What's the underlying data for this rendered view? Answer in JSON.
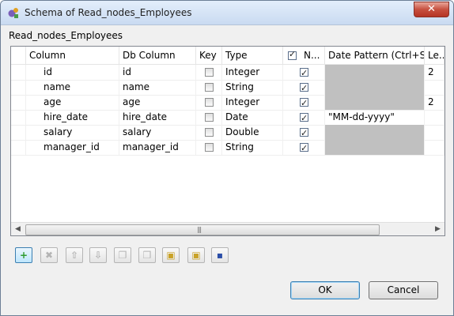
{
  "window": {
    "title": "Schema of Read_nodes_Employees",
    "close_glyph": "✕"
  },
  "schema_name": "Read_nodes_Employees",
  "table": {
    "columns": [
      "Column",
      "Db Column",
      "Key",
      "Type",
      "N...",
      "Date Pattern (Ctrl+S...",
      "Le..."
    ],
    "header_nullable_checked": true,
    "rows": [
      {
        "column": "id",
        "db_column": "id",
        "key": false,
        "type": "Integer",
        "nullable": true,
        "date_pattern": "",
        "date_pattern_disabled": true,
        "length": "2"
      },
      {
        "column": "name",
        "db_column": "name",
        "key": false,
        "type": "String",
        "nullable": true,
        "date_pattern": "",
        "date_pattern_disabled": true,
        "length": ""
      },
      {
        "column": "age",
        "db_column": "age",
        "key": false,
        "type": "Integer",
        "nullable": true,
        "date_pattern": "",
        "date_pattern_disabled": true,
        "length": "2"
      },
      {
        "column": "hire_date",
        "db_column": "hire_date",
        "key": false,
        "type": "Date",
        "nullable": true,
        "date_pattern": "\"MM-dd-yyyy\"",
        "date_pattern_disabled": false,
        "length": ""
      },
      {
        "column": "salary",
        "db_column": "salary",
        "key": false,
        "type": "Double",
        "nullable": true,
        "date_pattern": "",
        "date_pattern_disabled": true,
        "length": ""
      },
      {
        "column": "manager_id",
        "db_column": "manager_id",
        "key": false,
        "type": "String",
        "nullable": true,
        "date_pattern": "",
        "date_pattern_disabled": true,
        "length": ""
      }
    ]
  },
  "scrollbar": {
    "left_arrow": "◀",
    "right_arrow": "▶",
    "grip": "|||"
  },
  "toolbar": [
    {
      "name": "add-row-button",
      "icon": "plus-icon",
      "glyph": "+",
      "color": "#2e9b2e",
      "state": "active"
    },
    {
      "name": "delete-row-button",
      "icon": "x-icon",
      "glyph": "✖",
      "color": "#b4b4b4",
      "state": "disabled"
    },
    {
      "name": "move-up-button",
      "icon": "arrow-up-icon",
      "glyph": "⇧",
      "color": "#b4b4b4",
      "state": "disabled"
    },
    {
      "name": "move-down-button",
      "icon": "arrow-down-icon",
      "glyph": "⇩",
      "color": "#b4b4b4",
      "state": "disabled"
    },
    {
      "name": "copy-button",
      "icon": "copy-icon",
      "glyph": "❐",
      "color": "#b4b4b4",
      "state": "disabled"
    },
    {
      "name": "paste-button",
      "icon": "paste-icon",
      "glyph": "❒",
      "color": "#b4b4b4",
      "state": "disabled"
    },
    {
      "name": "import-schema-button",
      "icon": "folder-import-icon",
      "glyph": "▣",
      "color": "#c9a227",
      "state": "normal"
    },
    {
      "name": "export-schema-button",
      "icon": "folder-export-icon",
      "glyph": "▣",
      "color": "#c9a227",
      "state": "normal"
    },
    {
      "name": "save-schema-button",
      "icon": "save-disk-icon",
      "glyph": "▪",
      "color": "#2b4ea8",
      "state": "normal"
    }
  ],
  "buttons": {
    "ok": "OK",
    "cancel": "Cancel"
  }
}
